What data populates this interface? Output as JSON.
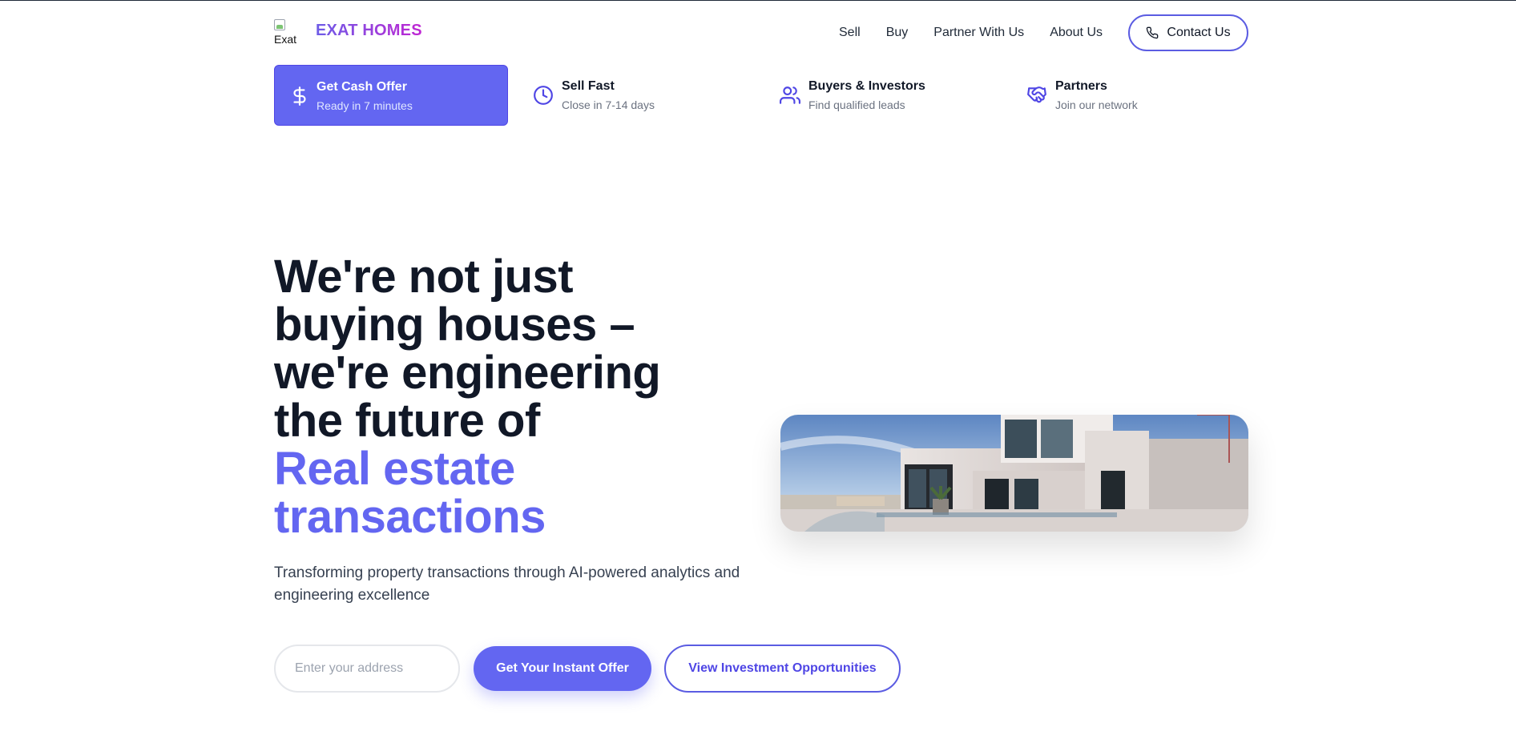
{
  "brand": {
    "logo_alt": "Exat",
    "name": "EXAT HOMES"
  },
  "nav": {
    "links": [
      "Sell",
      "Buy",
      "Partner With Us",
      "About Us"
    ],
    "contact_label": "Contact Us"
  },
  "tiles": [
    {
      "title": "Get Cash Offer",
      "subtitle": "Ready in 7 minutes",
      "icon": "dollar-icon",
      "active": true
    },
    {
      "title": "Sell Fast",
      "subtitle": "Close in 7-14 days",
      "icon": "clock-icon",
      "active": false
    },
    {
      "title": "Buyers & Investors",
      "subtitle": "Find qualified leads",
      "icon": "users-icon",
      "active": false
    },
    {
      "title": "Partners",
      "subtitle": "Join our network",
      "icon": "handshake-icon",
      "active": false
    }
  ],
  "hero": {
    "title_line1": "We're not just",
    "title_line2": "buying houses –",
    "title_line3": "we're engineering",
    "title_line4": "the future of",
    "accent_line1": "Real estate",
    "accent_line2": "transactions",
    "subtitle": "Transforming property transactions through AI-powered analytics and engineering excellence",
    "address_placeholder": "Enter your address",
    "address_value": "",
    "offer_button": "Get Your Instant Offer",
    "invest_button": "View Investment Opportunities"
  },
  "colors": {
    "accent": "#6366f1",
    "brand_gradient_start": "#6d5ce7",
    "brand_gradient_end": "#c026d3",
    "heading": "#111827"
  }
}
